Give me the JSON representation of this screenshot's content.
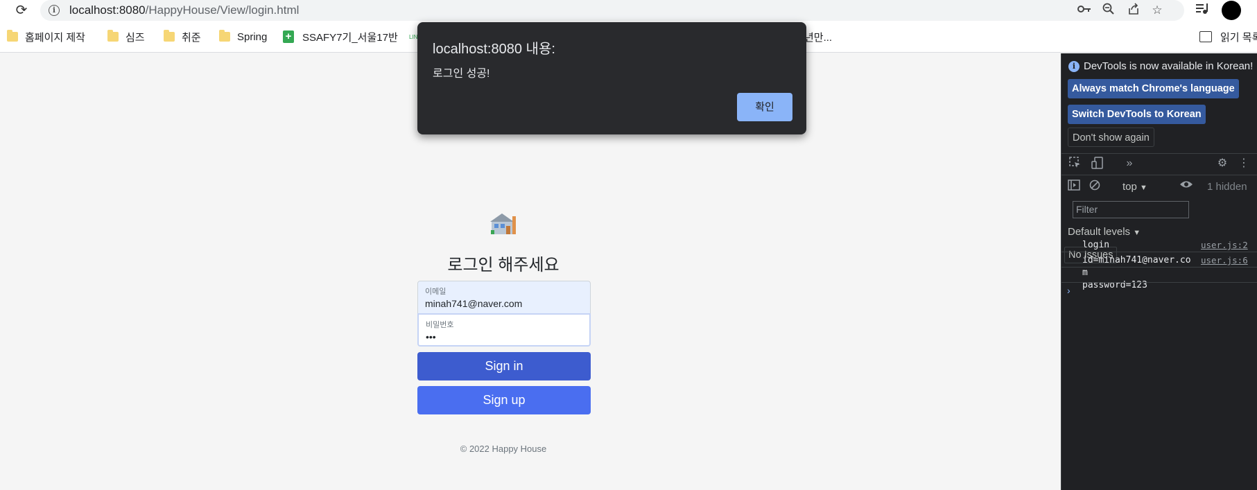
{
  "browser": {
    "url_host": "localhost:8080",
    "url_path": "/HappyHouse/View/login.html"
  },
  "bookmarks": [
    {
      "label": "홈페이지 제작",
      "icon": "folder-icon"
    },
    {
      "label": "심즈",
      "icon": "folder-icon"
    },
    {
      "label": "취준",
      "icon": "folder-icon"
    },
    {
      "label": "Spring",
      "icon": "folder-icon"
    },
    {
      "label": "SSAFY7기_서울17반",
      "icon": "sheets-icon"
    },
    {
      "label": "년만...",
      "icon": "none"
    },
    {
      "label": "읽기 목록",
      "icon": "reading-list-icon"
    }
  ],
  "dialog": {
    "title": "localhost:8080 내용:",
    "message": "로그인 성공!",
    "ok_label": "확인"
  },
  "login": {
    "title": "로그인 해주세요",
    "email_label": "이메일",
    "email_value": "minah741@naver.com",
    "password_label": "비밀번호",
    "password_value": "•••",
    "signin_label": "Sign in",
    "signup_label": "Sign up",
    "copyright": "© 2022 Happy House"
  },
  "devtools": {
    "notice": "DevTools is now available in Korean!",
    "match_language": "Always match Chrome's language",
    "switch_korean": "Switch DevTools to Korean",
    "dont_show": "Don't show again",
    "context": "top",
    "hidden_count": "1 hidden",
    "filter_placeholder": "Filter",
    "levels": "Default levels",
    "issues": "No Issues",
    "logs": [
      {
        "text": "login",
        "source": "user.js:2"
      },
      {
        "line1": "id=minah741@naver.co",
        "line2": "m",
        "line3": "password=123",
        "source": "user.js:6"
      }
    ],
    "prompt": "›"
  },
  "colors": {
    "primary_button": "#3d5ccf",
    "secondary_button": "#4a6ef0",
    "dialog_bg": "#292a2d",
    "dialog_ok": "#8ab4f8",
    "devtools_bg": "#202124"
  }
}
